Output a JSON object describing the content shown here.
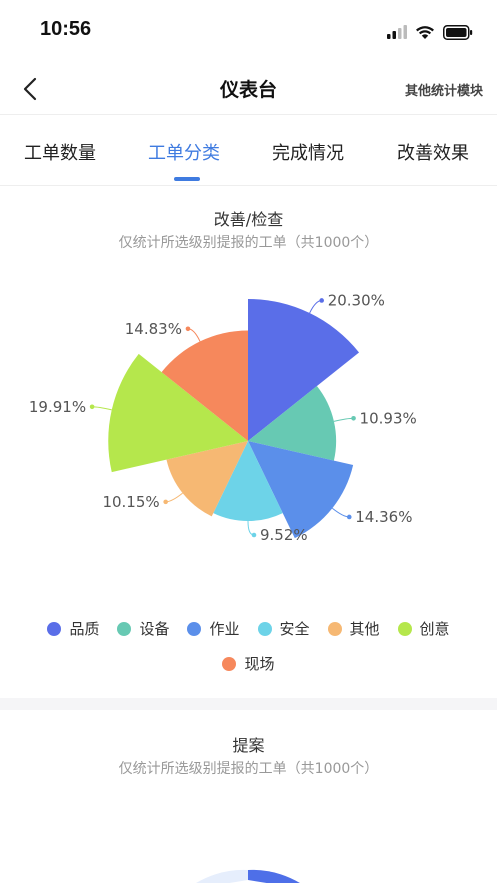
{
  "status": {
    "time": "10:56"
  },
  "nav": {
    "title": "仪表台",
    "right_label": "其他统计模块"
  },
  "tabs": [
    {
      "label": "工单数量"
    },
    {
      "label": "工单分类"
    },
    {
      "label": "完成情况"
    },
    {
      "label": "改善效果"
    }
  ],
  "active_tab": 1,
  "accent_color": "#3f7be0",
  "card1": {
    "title": "改善/检查",
    "subtitle": "仅统计所选级别提报的工单（共1000个）"
  },
  "card2": {
    "title": "提案",
    "subtitle": "仅统计所选级别提报的工单（共1000个）"
  },
  "chart_data": {
    "type": "pie",
    "rose": true,
    "title": "改善/检查",
    "subtitle": "仅统计所选级别提报的工单（共1000个）",
    "categories": [
      "品质",
      "设备",
      "作业",
      "安全",
      "其他",
      "创意",
      "现场"
    ],
    "values": [
      20.3,
      10.93,
      14.36,
      9.52,
      10.15,
      19.91,
      14.83
    ],
    "labels": [
      "20.30%",
      "10.93%",
      "14.36%",
      "9.52%",
      "10.15%",
      "19.91%",
      "14.83%"
    ],
    "colors": [
      "#5a6ee8",
      "#67c9b3",
      "#5b8fea",
      "#6dd3e8",
      "#f6b873",
      "#b5e74c",
      "#f6885c"
    ],
    "legend_position": "bottom"
  }
}
